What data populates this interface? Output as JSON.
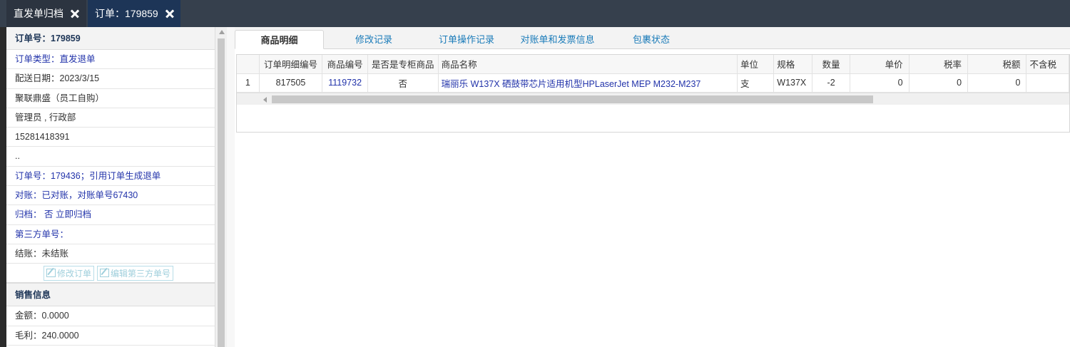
{
  "top_tabs": [
    {
      "label": "直发单归档"
    },
    {
      "label": "订单：179859"
    }
  ],
  "left": {
    "order_header": "订单号：179859",
    "rows": [
      {
        "text": "订单类型：直发退单",
        "color": "blue"
      },
      {
        "text": "配送日期：2023/3/15",
        "color": "dark"
      },
      {
        "text": "聚联鼎盛（员工自购）",
        "color": "dark"
      },
      {
        "text": "管理员 , 行政部",
        "color": "dark"
      },
      {
        "text": "15281418391",
        "color": "dark"
      },
      {
        "text": "..",
        "color": "dark"
      },
      {
        "text": "订单号：179436；引用订单生成退单",
        "color": "blue"
      },
      {
        "text": "对账：已对账，对账单号67430",
        "color": "blue"
      },
      {
        "text": "归档：  否 立即归档",
        "color": "blue"
      },
      {
        "text": "第三方单号：",
        "color": "blue"
      },
      {
        "text": "结账：未结账",
        "color": "dark"
      }
    ],
    "buttons": {
      "edit_order": "修改订单",
      "edit_third_party": "编辑第三方单号"
    },
    "sales_header": "销售信息",
    "sales_rows": [
      {
        "text": "金额：0.0000"
      },
      {
        "text": "毛利：240.0000"
      }
    ]
  },
  "content_tabs": [
    {
      "label": "商品明细",
      "active": true
    },
    {
      "label": "修改记录",
      "active": false
    },
    {
      "label": "订单操作记录",
      "active": false
    },
    {
      "label": "对账单和发票信息",
      "active": false
    },
    {
      "label": "包裹状态",
      "active": false
    }
  ],
  "table": {
    "headers": [
      "",
      "订单明细编号",
      "商品编号",
      "是否是专柜商品",
      "商品名称",
      "单位",
      "规格",
      "数量",
      "单价",
      "税率",
      "税额",
      "不含税"
    ],
    "rows": [
      {
        "index": "1",
        "detail_id": "817505",
        "product_id": "1119732",
        "counter": "否",
        "name": "瑞丽乐 W137X 硒鼓带芯片适用机型HPLaserJet MEP M232-M237",
        "unit": "支",
        "spec": "W137X",
        "qty": "-2",
        "price": "0",
        "tax_rate": "0",
        "tax_amount": "0",
        "untaxed": ""
      }
    ]
  },
  "colors": {
    "topbar": "#36404d",
    "active_top_tab": "#1d3557",
    "link_blue": "#2233aa",
    "tab_blue": "#1a7bb9"
  }
}
